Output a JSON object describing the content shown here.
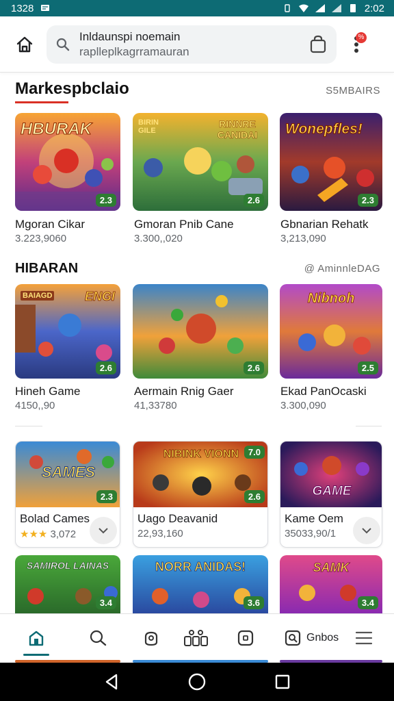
{
  "status_bar": {
    "time": "1328",
    "right_time": "2:02",
    "notification_icon": "message-icon",
    "colors": {
      "bg": "#0d6b74"
    }
  },
  "top_bar": {
    "search_line1": "Inldaunspi noemain",
    "search_line2": "raplleplkagrramauran",
    "icons": [
      "home-icon",
      "search-icon",
      "shopping-bag-icon",
      "more-vert-icon"
    ],
    "notification_badge": "%"
  },
  "section1": {
    "title": "Markespbclaio",
    "link": "S5MBAIRS",
    "cards": [
      {
        "banner": "HBURAK",
        "rating": "2.3",
        "name": "Mgoran Cikar",
        "sub": "3.223,9060"
      },
      {
        "banner": "RINNRE CANIDAI",
        "badge_left": "BIRIN GILE",
        "rating": "2.6",
        "name": "Gmoran Pnib Cane",
        "sub": "3.300,,020"
      },
      {
        "banner": "Wonepfles!",
        "rating": "2.3",
        "name": "Gbnarian Rehatk",
        "sub": "3,213,090"
      }
    ]
  },
  "section2": {
    "title": "HIBARAN",
    "link": "@ AminnleDAG",
    "cards": [
      {
        "banner": "ENGI",
        "badge_left": "BAIAGD",
        "rating": "2.6",
        "name": "Hineh Game",
        "sub": "4150,,90"
      },
      {
        "rating": "2.6",
        "name": "Aermain Rnig Gaer",
        "sub": "41,33780"
      },
      {
        "banner": "Nibnoh",
        "rating": "2.5",
        "name": "Ekad PanOcaski",
        "sub": "3.300,090"
      }
    ]
  },
  "section3": {
    "cards": [
      {
        "banner": "SAMES",
        "rating": "2.3",
        "name": "Bolad Cames",
        "stars": "★★★",
        "sub": "3,072"
      },
      {
        "banner": "NIBINK VIONN",
        "rating": "2.6",
        "rating_top": "7.0",
        "name": "Uago Deavanid",
        "sub": "22,93,160"
      },
      {
        "banner": "GAME",
        "name": "Kame Oem",
        "sub": "35033,90/1"
      }
    ]
  },
  "section4": {
    "cards": [
      {
        "banner": "SAMIROL LAINAS",
        "rating": "3.4"
      },
      {
        "banner": "NORR ANIDAS!",
        "rating": "3.6"
      },
      {
        "banner": "SAMK",
        "rating": "3.4"
      }
    ]
  },
  "bottom_nav": {
    "items": [
      {
        "icon": "store-home-icon",
        "active": true
      },
      {
        "icon": "search-icon"
      },
      {
        "icon": "games-icon"
      },
      {
        "icon": "apps-icon"
      },
      {
        "icon": "books-icon"
      },
      {
        "icon": "library-icon",
        "label": "Gnbos"
      },
      {
        "icon": "menu-icon"
      }
    ]
  },
  "colors": {
    "accent": "#0d6b74",
    "title_underline": "#d93025",
    "rating_bg": "#2e7d32"
  }
}
